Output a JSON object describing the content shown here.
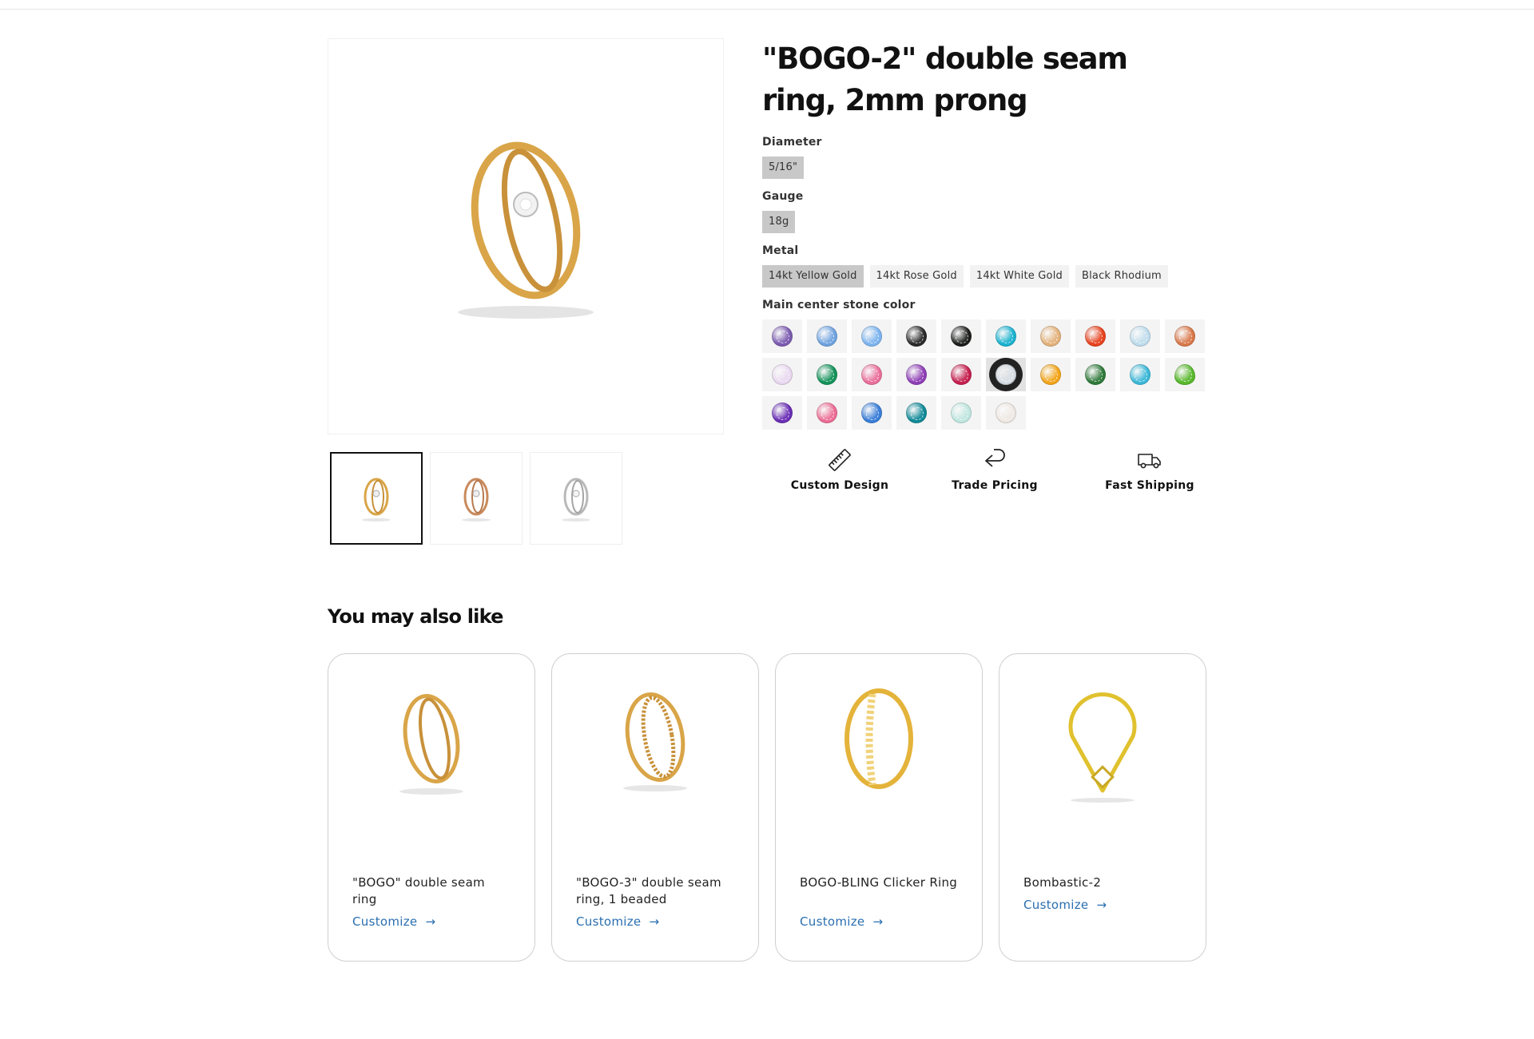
{
  "product": {
    "title": "\"BOGO-2\" double seam ring, 2mm prong"
  },
  "options": {
    "diameter": {
      "label": "Diameter",
      "values": [
        "5/16\""
      ],
      "selected": "5/16\""
    },
    "gauge": {
      "label": "Gauge",
      "values": [
        "18g"
      ],
      "selected": "18g"
    },
    "metal": {
      "label": "Metal",
      "values": [
        "14kt Yellow Gold",
        "14kt Rose Gold",
        "14kt White Gold",
        "Black Rhodium"
      ],
      "selected": "14kt Yellow Gold"
    },
    "stone": {
      "label": "Main center stone color",
      "colors": [
        "#7b5bb0",
        "#6fa3e0",
        "#7db4ef",
        "#2a2a2a",
        "#1d1f1c",
        "#1bb2cf",
        "#e3b27b",
        "#e8431f",
        "#bfdcec",
        "#d8784a",
        "#e9d8f0",
        "#14925a",
        "#ea6f9b",
        "#8e3fb5",
        "#c5204f",
        "#d6dde4",
        "#f3a51a",
        "#2f7a3a",
        "#3cb8d8",
        "#58b82d",
        "#6a2fb5",
        "#ec6d95",
        "#3a7ed8",
        "#118a98",
        "#bfe6df",
        "#eee8e2"
      ],
      "selected_index": 15
    }
  },
  "features": [
    {
      "label": "Custom Design",
      "icon": "ruler-icon"
    },
    {
      "label": "Trade Pricing",
      "icon": "return-arrow-icon"
    },
    {
      "label": "Fast Shipping",
      "icon": "truck-icon"
    }
  ],
  "related": {
    "title": "You may also like",
    "items": [
      {
        "name": "\"BOGO\" double seam ring",
        "link": "Customize"
      },
      {
        "name": "\"BOGO-3\" double seam ring, 1 beaded",
        "link": "Customize"
      },
      {
        "name": "BOGO-BLING Clicker Ring",
        "link": "Customize"
      },
      {
        "name": "Bombastic-2",
        "link": "Customize"
      }
    ]
  },
  "colors": {
    "gold": "#d9a548",
    "rose_gold": "#c98a5c",
    "white_gold": "#b9b9b9",
    "link": "#2a6fb0"
  }
}
